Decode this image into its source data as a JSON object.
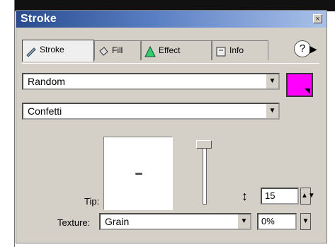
{
  "panel": {
    "title": "Stroke"
  },
  "tabs": [
    {
      "label": "Stroke",
      "icon": "pencil-icon"
    },
    {
      "label": "Fill",
      "icon": "bucket-icon"
    },
    {
      "label": "Effect",
      "icon": "effect-icon"
    },
    {
      "label": "Info",
      "icon": "info-icon"
    }
  ],
  "stroke_category": "Random",
  "stroke_type": "Confetti",
  "stroke_color": "#ff00ff",
  "tip_label": "Tip:",
  "tip_size": "15",
  "texture_label": "Texture:",
  "texture_value": "Grain",
  "texture_amount": "0%"
}
